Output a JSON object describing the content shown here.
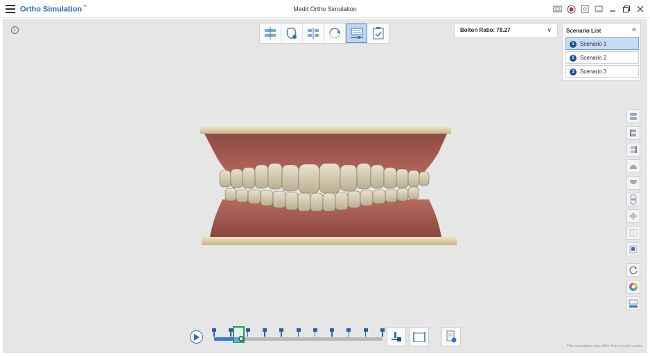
{
  "titlebar": {
    "app_name": "Ortho Simulation",
    "app_badge": "³¹",
    "window_title": "Medit Ortho Simulation",
    "icons": [
      "screen-capture-icon",
      "record-icon",
      "snapshot-icon",
      "fullscreen-icon",
      "minimize-icon",
      "maximize-icon",
      "close-icon"
    ]
  },
  "viewport": {
    "info_glyph": "i"
  },
  "mode_toolbar": {
    "buttons": [
      "align-arches-icon",
      "tooth-segmentation-icon",
      "axis-setup-icon",
      "arch-rotate-icon",
      "movement-table-icon",
      "finish-check-icon"
    ],
    "active_index": 4
  },
  "bolton": {
    "label": "Bolton Ratio: 78.27",
    "chevron": "∨"
  },
  "scenario_list": {
    "title": "Scenario List",
    "collapse_glyph": "»",
    "items": [
      {
        "num": "1",
        "label": "Scenario 1",
        "selected": true
      },
      {
        "num": "2",
        "label": "Scenario 2",
        "selected": false
      },
      {
        "num": "3",
        "label": "Scenario 3",
        "selected": false
      }
    ]
  },
  "right_toolbar": {
    "icons": [
      "bite-view-icon",
      "left-view-icon",
      "right-view-icon",
      "upper-arch-icon",
      "lower-arch-icon",
      "overlay-icon",
      "axis-icon",
      "split-view-icon",
      "single-view-icon",
      "reset-view-icon",
      "color-wheel-icon",
      "display-settings-icon"
    ]
  },
  "timeline": {
    "stage_count": 11,
    "current_stage_index": 1,
    "progress_fraction": 0.15
  },
  "colors": {
    "accent": "#2e6fc0",
    "current_stage_highlight": "#19a34b",
    "selected_row": "#c7dcf1"
  },
  "disclaimer": "This simulation may differ from actual results."
}
